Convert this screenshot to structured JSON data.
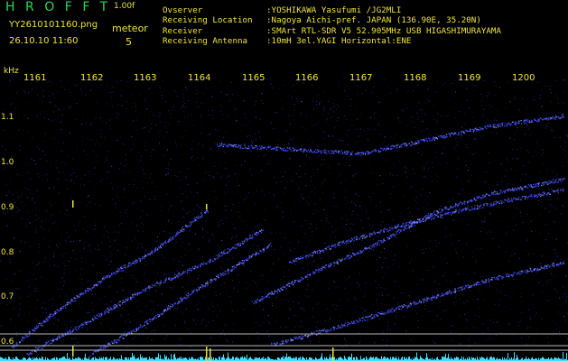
{
  "app": {
    "name": "HROFFT",
    "version": "1.00f"
  },
  "file": {
    "name": "YY2610101160.png",
    "datetime": "26.10.10 11:60"
  },
  "meteor": {
    "label": "meteor",
    "count": "5"
  },
  "info": [
    {
      "label": "Ovserver",
      "value": ":YOSHIKAWA Yasufumi /JG2MLI"
    },
    {
      "label": "Receiving Location",
      "value": ":Nagoya Aichi-pref. JAPAN (136.90E, 35.20N)"
    },
    {
      "label": "Receiver",
      "value": ":SMArt RTL-SDR V5 52.905MHz USB HIGASHIMURAYAMA"
    },
    {
      "label": "Receiving Antenna",
      "value": ":10mH 3el.YAGI Horizontal:ENE"
    }
  ],
  "axis": {
    "unit": "kHz",
    "minutes": [
      "1161",
      "1162",
      "1163",
      "1164",
      "1165",
      "1166",
      "1167",
      "1168",
      "1169",
      "1200"
    ],
    "freq_ticks": [
      "1.1",
      "1.0",
      "0.9",
      "0.8",
      "0.7",
      "0.6"
    ]
  },
  "colors": {
    "text": "#f0e43c",
    "title": "#2fd35a",
    "echo": "#3c48e6",
    "noise": "#2a2fb0",
    "baseline": "#3fe0ff"
  }
}
